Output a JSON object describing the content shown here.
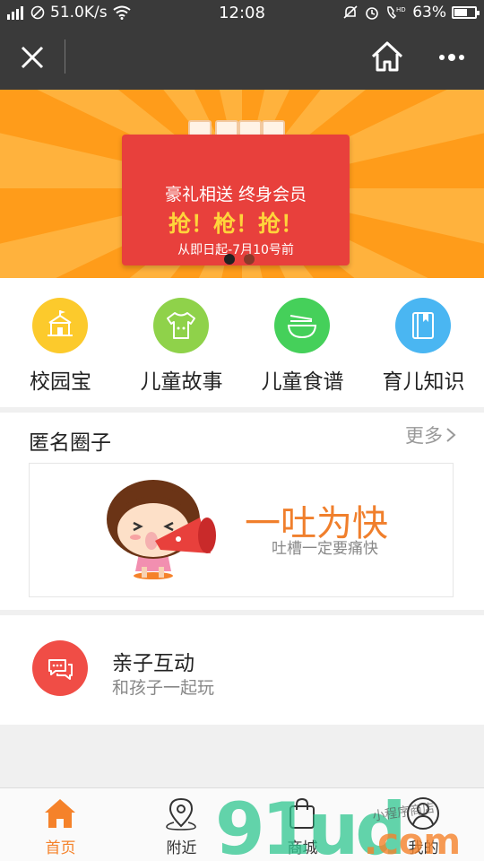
{
  "status_bar": {
    "network_speed": "51.0K/s",
    "time": "12:08",
    "battery_percent": "63%",
    "battery_level": 0.63,
    "icons": [
      "signal-icon",
      "blocked-icon",
      "wifi-icon",
      "mute-icon",
      "alarm-icon",
      "hd-call-icon",
      "battery-icon"
    ]
  },
  "title_bar": {
    "icons": [
      "close-icon",
      "home-icon",
      "more-icon"
    ]
  },
  "banner": {
    "line1": "豪礼相送  终身会员",
    "line2": "抢！枪！抢！",
    "line3": "从即日起-7月10号前",
    "slide_count": 2,
    "active_slide": 1,
    "colors": {
      "background": "#ff9c1a",
      "envelope": "#e8403c",
      "accent_text": "#ffd43b"
    }
  },
  "categories": [
    {
      "label": "校园宝",
      "icon": "school-icon",
      "color": "#fcca2c"
    },
    {
      "label": "儿童故事",
      "icon": "baby-clothes-icon",
      "color": "#8fd24a"
    },
    {
      "label": "儿童食谱",
      "icon": "bowl-icon",
      "color": "#45d05a"
    },
    {
      "label": "育儿知识",
      "icon": "book-icon",
      "color": "#4ab6f2"
    }
  ],
  "anon_section": {
    "title": "匿名圈子",
    "more": "更多",
    "slogan": "一吐为快",
    "slogan_sub": "吐槽一定要痛快"
  },
  "family_section": {
    "title": "亲子互动",
    "subtitle": "和孩子一起玩",
    "icon": "chat-icon",
    "color": "#f04d46"
  },
  "tab_bar": {
    "active_color": "#f5822a",
    "tabs": [
      {
        "label": "首页",
        "icon": "home-tab-icon",
        "active": true
      },
      {
        "label": "附近",
        "icon": "location-icon",
        "active": false
      },
      {
        "label": "商城",
        "icon": "shopping-bag-icon",
        "active": false
      },
      {
        "label": "我的",
        "icon": "user-icon",
        "active": false
      }
    ]
  },
  "watermark": {
    "logo": "91ud",
    "domain": ".com",
    "tagline": "小程序商店"
  }
}
